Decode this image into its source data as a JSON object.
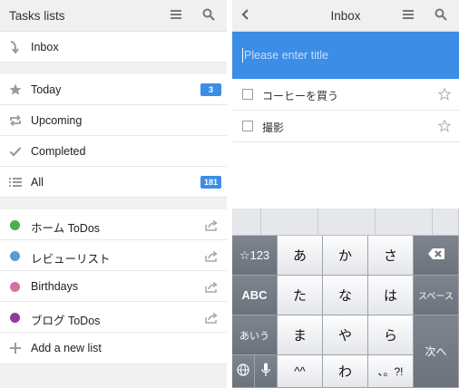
{
  "left_panel": {
    "header_title": "Tasks lists",
    "inbox_label": "Inbox",
    "smart_lists": [
      {
        "label": "Today",
        "badge": "3",
        "icon": "star-icon"
      },
      {
        "label": "Upcoming",
        "icon": "repeat-icon"
      },
      {
        "label": "Completed",
        "icon": "check-icon"
      },
      {
        "label": "All",
        "badge": "181",
        "icon": "list-icon"
      }
    ],
    "lists": [
      {
        "label": "ホーム ToDos",
        "color": "#4caf50"
      },
      {
        "label": "レビューリスト",
        "color": "#5b9bd5"
      },
      {
        "label": "Birthdays",
        "color": "#d271a6"
      },
      {
        "label": "ブログ ToDos",
        "color": "#8e3c99"
      }
    ],
    "add_list_label": "Add a new list"
  },
  "right_panel": {
    "header_title": "Inbox",
    "title_placeholder": "Please enter title",
    "tasks": [
      {
        "text": "コーヒーを買う"
      },
      {
        "text": "撮影"
      }
    ]
  },
  "keyboard": {
    "row1": [
      "☆123",
      "あ",
      "か",
      "さ"
    ],
    "row2": [
      "ABC",
      "た",
      "な",
      "は",
      "スペース"
    ],
    "row3": [
      "あいう",
      "ま",
      "や",
      "ら"
    ],
    "row4": [
      "^^",
      "わ",
      "、。?!"
    ],
    "enter_label": "次へ"
  },
  "colors": {
    "accent_blue": "#3b8de6",
    "badge_blue": "#3b8de6"
  }
}
